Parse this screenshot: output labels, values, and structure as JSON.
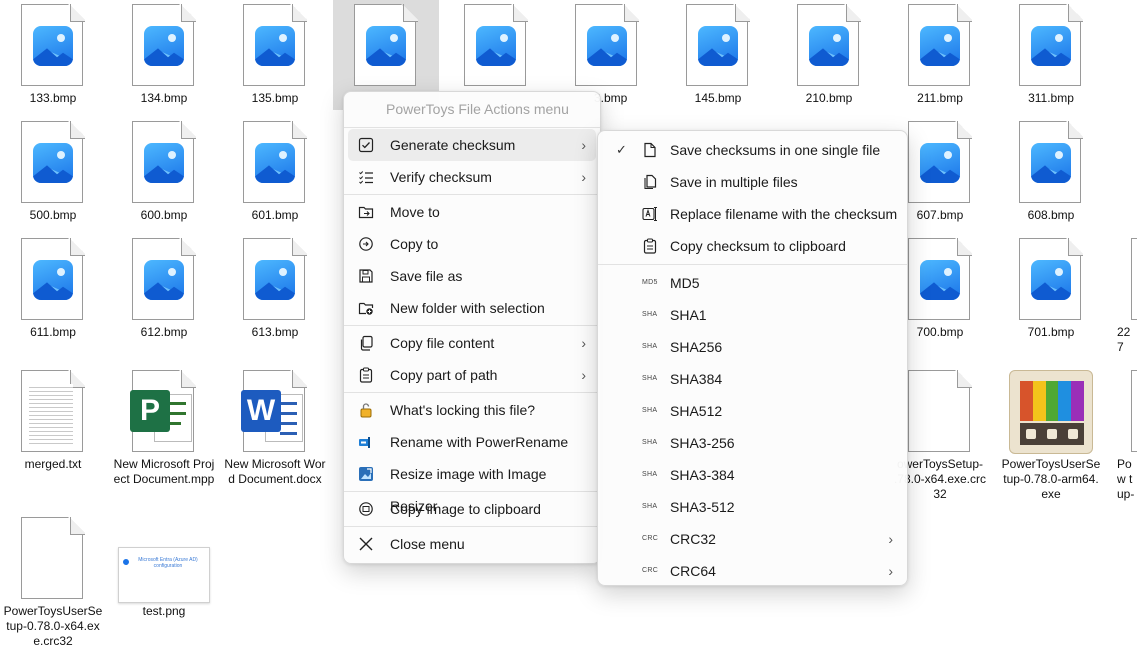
{
  "files": [
    {
      "name": "133.bmp",
      "kind": "image"
    },
    {
      "name": "134.bmp",
      "kind": "image"
    },
    {
      "name": "135.bmp",
      "kind": "image"
    },
    {
      "name": "",
      "kind": "image",
      "selected": true
    },
    {
      "name": "",
      "kind": "image"
    },
    {
      "name": "3.bmp",
      "kind": "image"
    },
    {
      "name": "145.bmp",
      "kind": "image"
    },
    {
      "name": "210.bmp",
      "kind": "image"
    },
    {
      "name": "211.bmp",
      "kind": "image"
    },
    {
      "name": "311.bmp",
      "kind": "image"
    },
    {
      "name": "500.bmp",
      "kind": "image"
    },
    {
      "name": "600.bmp",
      "kind": "image"
    },
    {
      "name": "601.bmp",
      "kind": "image"
    },
    {
      "name": "607.bmp",
      "kind": "image"
    },
    {
      "name": "608.bmp",
      "kind": "image"
    },
    {
      "name": "611.bmp",
      "kind": "image"
    },
    {
      "name": "612.bmp",
      "kind": "image"
    },
    {
      "name": "613.bmp",
      "kind": "image"
    },
    {
      "name": "700.bmp",
      "kind": "image"
    },
    {
      "name": "701.bmp",
      "kind": "image"
    },
    {
      "name": "227",
      "kind": "image"
    },
    {
      "name": "merged.txt",
      "kind": "text"
    },
    {
      "name": "New Microsoft Project Document.mpp",
      "kind": "project"
    },
    {
      "name": "New Microsoft Word Document.docx",
      "kind": "word"
    },
    {
      "name": "PowerToysSetup-0.78.0-x64.exe.crc32",
      "kind": "blank",
      "display": "owerToysSetup-\n.78.0-x64.exe.crc\n32"
    },
    {
      "name": "PowerToysUserSetup-0.78.0-arm64.exe",
      "kind": "powertoys"
    },
    {
      "name": "Pow tup-",
      "kind": "blank"
    },
    {
      "name": "PowerToysUserSetup-0.78.0-x64.exe.crc32",
      "kind": "blank"
    },
    {
      "name": "test.png",
      "kind": "screenshot",
      "thumb_text": "Microsoft Entra (Azure AD) configuration"
    }
  ],
  "menu": {
    "title": "PowerToys File Actions menu",
    "items": [
      {
        "label": "Generate checksum",
        "icon": "checkbox-icon",
        "submenu": true,
        "hover": true
      },
      {
        "label": "Verify checksum",
        "icon": "checklist-icon",
        "submenu": true
      },
      {
        "label": "Move to",
        "icon": "folder-move-icon"
      },
      {
        "label": "Copy to",
        "icon": "copy-to-icon"
      },
      {
        "label": "Save file as",
        "icon": "save-icon"
      },
      {
        "label": "New folder with selection",
        "icon": "new-folder-icon"
      },
      {
        "label": "Copy file content",
        "icon": "copy-icon",
        "submenu": true
      },
      {
        "label": "Copy part of path",
        "icon": "clipboard-icon",
        "submenu": true
      },
      {
        "label": "What's locking this file?",
        "icon": "lock-icon"
      },
      {
        "label": "Rename with PowerRename",
        "icon": "powerrename-icon"
      },
      {
        "label": "Resize image with Image Resizer",
        "icon": "image-resizer-icon"
      },
      {
        "label": "Copy image to clipboard",
        "icon": "copy-image-icon"
      },
      {
        "label": "Close menu",
        "icon": "close-icon"
      }
    ]
  },
  "submenu": {
    "items": [
      {
        "label": "Save checksums in one single file",
        "icon": "file-icon",
        "checked": true
      },
      {
        "label": "Save in multiple files",
        "icon": "files-icon"
      },
      {
        "label": "Replace filename with the checksum",
        "icon": "rename-icon"
      },
      {
        "label": "Copy checksum to clipboard",
        "icon": "clipboard-icon"
      }
    ],
    "algorithms": [
      {
        "tag": "MD5",
        "label": "MD5"
      },
      {
        "tag": "SHA",
        "label": "SHA1"
      },
      {
        "tag": "SHA",
        "label": "SHA256"
      },
      {
        "tag": "SHA",
        "label": "SHA384"
      },
      {
        "tag": "SHA",
        "label": "SHA512"
      },
      {
        "tag": "SHA",
        "label": "SHA3-256"
      },
      {
        "tag": "SHA",
        "label": "SHA3-384"
      },
      {
        "tag": "SHA",
        "label": "SHA3-512"
      },
      {
        "tag": "CRC",
        "label": "CRC32",
        "submenu": true
      },
      {
        "tag": "CRC",
        "label": "CRC64",
        "submenu": true
      }
    ]
  },
  "colors": {
    "accent": "#1a73e8",
    "menu_bg": "#fcfcfc",
    "hover": "#ececec",
    "selected_file": "#dcdcdc"
  }
}
